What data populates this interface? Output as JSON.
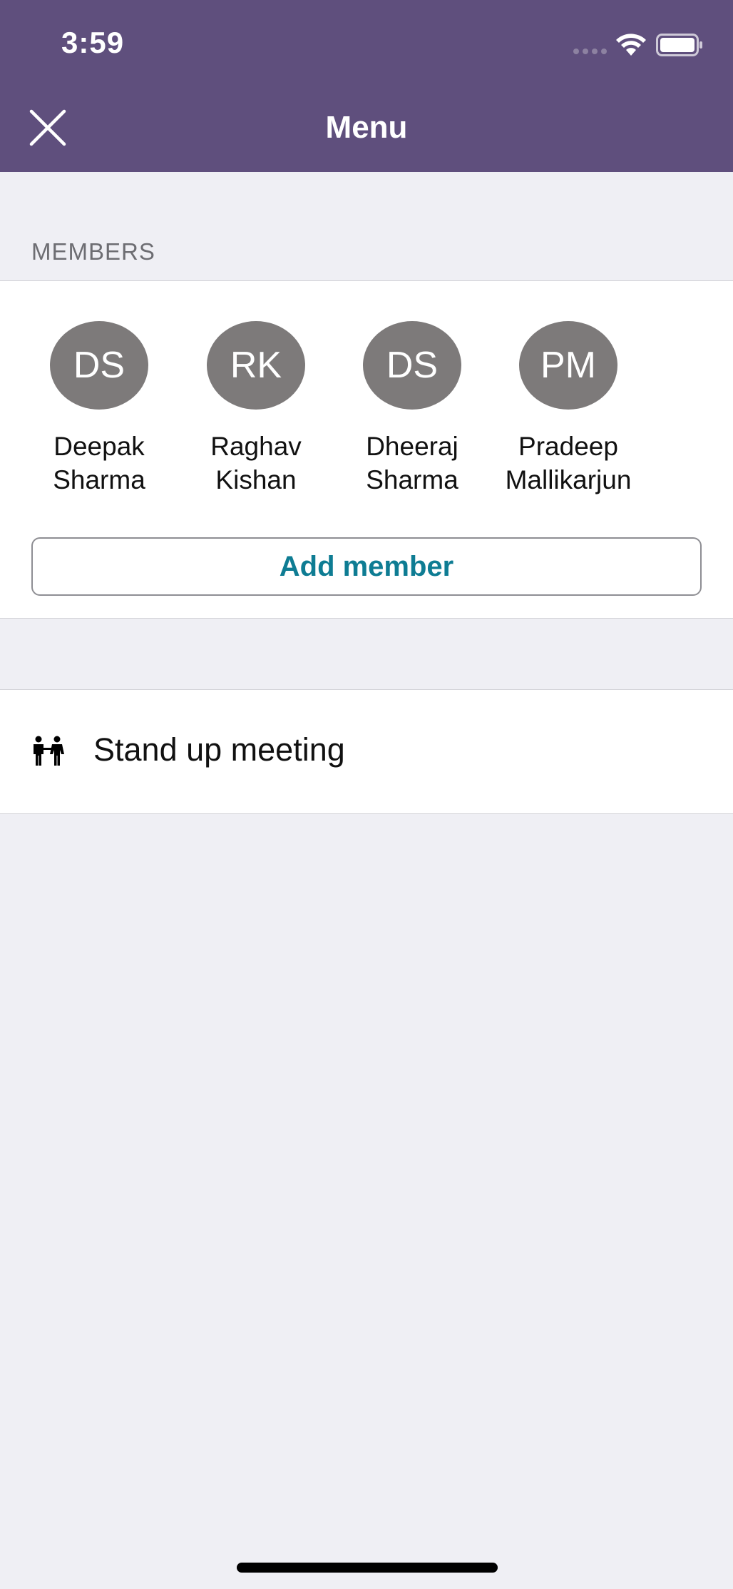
{
  "status_bar": {
    "time": "3:59"
  },
  "header": {
    "title": "Menu"
  },
  "members_section": {
    "label": "MEMBERS",
    "members": [
      {
        "initials": "DS",
        "name": "Deepak\nSharma"
      },
      {
        "initials": "RK",
        "name": "Raghav\nKishan"
      },
      {
        "initials": "DS",
        "name": "Dheeraj\nSharma"
      },
      {
        "initials": "PM",
        "name": "Pradeep\nMallikarjun"
      }
    ],
    "add_member_label": "Add member"
  },
  "menu_items": [
    {
      "label": "Stand up meeting",
      "icon": "people-icon"
    }
  ],
  "colors": {
    "header_bg": "#5F4F7D",
    "avatar_bg": "#7D7A7A",
    "accent": "#0E7C93",
    "page_bg": "#EFEFF4"
  }
}
